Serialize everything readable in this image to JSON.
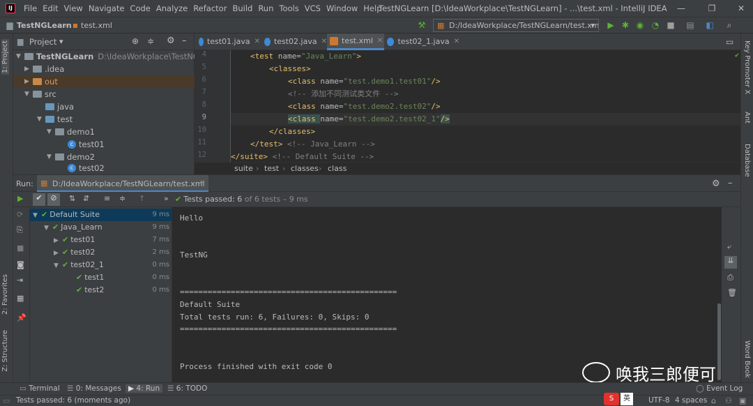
{
  "menubar": {
    "logo_text": "IJ",
    "items": [
      "File",
      "Edit",
      "View",
      "Navigate",
      "Code",
      "Analyze",
      "Refactor",
      "Build",
      "Run",
      "Tools",
      "VCS",
      "Window",
      "Help"
    ],
    "title": "TestNGLearn [D:\\IdeaWorkplace\\TestNGLearn] - ...\\test.xml - IntelliJ IDEA",
    "window_buttons": [
      "—",
      "❐",
      "✕"
    ]
  },
  "toolbar": {
    "crumb_project": "TestNGLearn",
    "crumb_file": "test.xml",
    "run_config": "D:/IdeaWorkplace/TestNGLearn/test.xml"
  },
  "left_strip": {
    "project_tab": "1: Project",
    "favorites_tab": "2: Favorites",
    "structure_tab": "Z: Structure"
  },
  "right_strip": {
    "key_promoter": "Key Promoter X",
    "ant": "Ant",
    "database": "Database",
    "word_book": "Word Book"
  },
  "project": {
    "header_label": "Project",
    "tree": [
      {
        "label": "TestNGLearn",
        "path": "D:\\IdeaWorkplace\\TestNGLearn",
        "type": "root"
      },
      {
        "label": ".idea",
        "type": "folder"
      },
      {
        "label": "out",
        "type": "folder-orange"
      },
      {
        "label": "src",
        "type": "folder"
      },
      {
        "label": "java",
        "type": "folder-blue"
      },
      {
        "label": "test",
        "type": "folder-blue"
      },
      {
        "label": "demo1",
        "type": "package"
      },
      {
        "label": "test01",
        "type": "class"
      },
      {
        "label": "demo2",
        "type": "package"
      },
      {
        "label": "test02",
        "type": "class"
      }
    ]
  },
  "editor": {
    "tabs": [
      {
        "label": "test01.java"
      },
      {
        "label": "test02.java"
      },
      {
        "label": "test.xml"
      },
      {
        "label": "test02_1.java"
      }
    ],
    "line_numbers": [
      "4",
      "5",
      "6",
      "7",
      "8",
      "9",
      "10",
      "11",
      "12"
    ],
    "code": {
      "l4_tag_open": "<test ",
      "l4_attr": "name=",
      "l4_val": "\"Java_Learn\"",
      "l4_close": ">",
      "l5": "<classes>",
      "l6_tag": "<class ",
      "l6_attr": "name=",
      "l6_val": "\"test.demo1.test01\"",
      "l6_close": "/>",
      "l7": "<!-- 添加不同测试类文件 -->",
      "l8_tag": "<class ",
      "l8_attr": "name=",
      "l8_val": "\"test.demo2.test02\"",
      "l8_close": "/>",
      "l9_tag": "<class ",
      "l9_attr": "name=",
      "l9_val": "\"test.demo2.test02_1\"",
      "l9_close": "/>",
      "l10": "</classes>",
      "l11_tag": "</test>",
      "l11_cm": "<!-- Java_Learn -->",
      "l12_tag": "</suite>",
      "l12_cm": "<!-- Default Suite -->"
    },
    "breadcrumb": [
      "suite",
      "test",
      "classes",
      "class"
    ]
  },
  "run": {
    "label": "Run:",
    "config_tab": "D:/IdeaWorkplace/TestNGLearn/test.xml",
    "status_prefix": "Tests passed:",
    "status_count": "6",
    "status_suffix": "of 6 tests – 9 ms",
    "tree": [
      {
        "name": "Default Suite",
        "time": "9 ms"
      },
      {
        "name": "Java_Learn",
        "time": "9 ms"
      },
      {
        "name": "test01",
        "time": "7 ms"
      },
      {
        "name": "test02",
        "time": "2 ms"
      },
      {
        "name": "test02_1",
        "time": "0 ms"
      },
      {
        "name": "test1",
        "time": "0 ms"
      },
      {
        "name": "test2",
        "time": "0 ms"
      }
    ],
    "console": [
      "Hello",
      "TestNG",
      "===============================================",
      "Default Suite",
      "Total tests run: 6, Failures: 0, Skips: 0",
      "===============================================",
      "Process finished with exit code 0"
    ]
  },
  "bottom_tabs": [
    "Terminal",
    "0: Messages",
    "4: Run",
    "6: TODO"
  ],
  "event_log": "Event Log",
  "status": {
    "message": "Tests passed: 6 (moments ago)",
    "ime": "英",
    "encoding": "UTF-8",
    "indent": "4 spaces"
  },
  "watermark": "唤我三郎便可",
  "colors": {
    "accent": "#4a88c7",
    "pass_green": "#5fb236",
    "selection": "#0d3a58"
  }
}
